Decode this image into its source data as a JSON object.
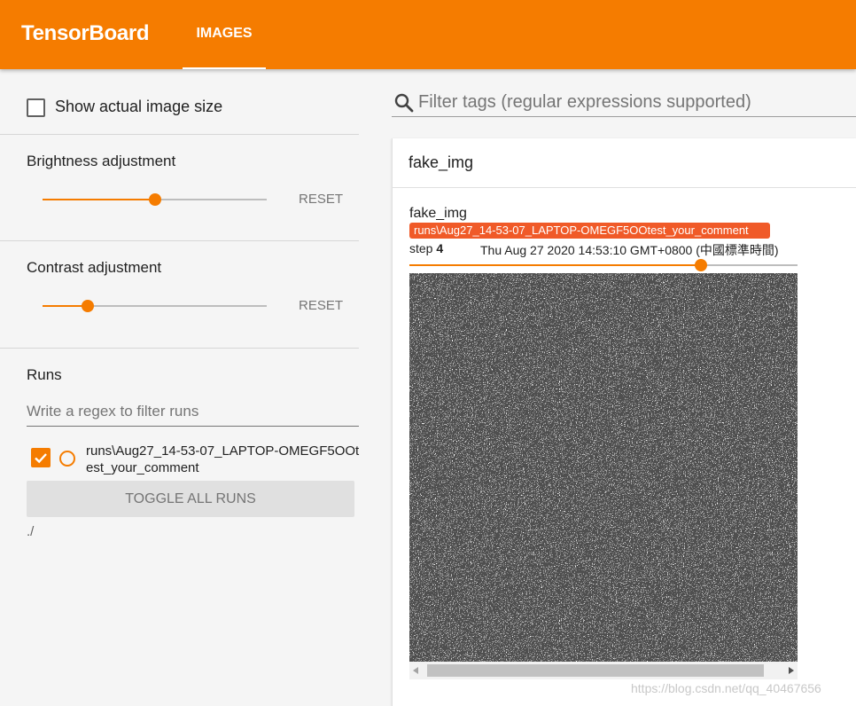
{
  "header": {
    "brand": "TensorBoard",
    "tabs": [
      {
        "label": "IMAGES",
        "active": true
      }
    ]
  },
  "sidebar": {
    "show_actual_size": {
      "label": "Show actual image size",
      "checked": false
    },
    "brightness": {
      "title": "Brightness adjustment",
      "value": 0.5,
      "reset_label": "RESET"
    },
    "contrast": {
      "title": "Contrast adjustment",
      "value": 0.2,
      "reset_label": "RESET"
    },
    "runs": {
      "title": "Runs",
      "filter_placeholder": "Write a regex to filter runs",
      "items": [
        {
          "name": "runs\\Aug27_14-53-07_LAPTOP-OMEGF5OOtest_your_comment",
          "checked": true
        }
      ],
      "toggle_all_label": "TOGGLE ALL RUNS",
      "log_dir": "./"
    }
  },
  "main": {
    "filter_placeholder": "Filter tags (regular expressions supported)",
    "card": {
      "title": "fake_img",
      "image": {
        "tag": "fake_img",
        "run": "runs\\Aug27_14-53-07_LAPTOP-OMEGF5OOtest_your_comment",
        "step_prefix": "step",
        "step": "4",
        "timestamp": "Thu Aug 27 2020 14:53:10 GMT+0800 (中國標準時間)",
        "step_slider_value": 0.75
      }
    }
  },
  "watermark": "https://blog.csdn.net/qq_40467656",
  "colors": {
    "accent": "#f57c00",
    "run_badge": "#f05a28"
  }
}
